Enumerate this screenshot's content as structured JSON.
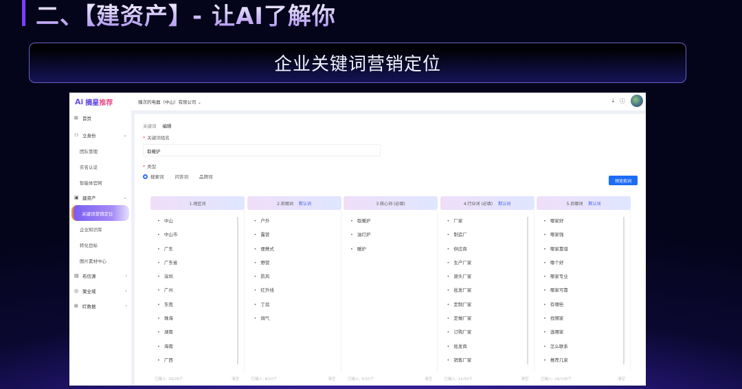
{
  "slide": {
    "title": "二、【建资产】- 让AI了解你",
    "banner": "企业关键词营销定位"
  },
  "app": {
    "logo": {
      "ai": "Ai",
      "name1": "摘星",
      "name2": "推荐"
    },
    "company": "臻次的电器（中山）有限公司",
    "sidebar": [
      {
        "label": "首页",
        "icon": "grid-icon",
        "type": "top"
      },
      {
        "label": "立身份",
        "icon": "user-icon",
        "type": "group",
        "open": true
      },
      {
        "label": "团队管理",
        "type": "sub"
      },
      {
        "label": "实名认证",
        "type": "sub"
      },
      {
        "label": "智能体官网",
        "type": "sub"
      },
      {
        "label": "建资产",
        "icon": "monitor-icon",
        "type": "group",
        "open": true
      },
      {
        "label": "关键词营销定位",
        "type": "sub",
        "active": true
      },
      {
        "label": "企业知识库",
        "type": "sub"
      },
      {
        "label": "转化目标",
        "type": "sub"
      },
      {
        "label": "图片素材中心",
        "type": "sub"
      },
      {
        "label": "布信源",
        "icon": "book-icon",
        "type": "group"
      },
      {
        "label": "聚全域",
        "icon": "globe-icon",
        "type": "group"
      },
      {
        "label": "盯数据",
        "icon": "grid-icon",
        "type": "group"
      }
    ],
    "breadcrumb": {
      "parent": "关键词",
      "current": "编辑"
    },
    "form": {
      "name_label": "关键词组名",
      "name_value": "取暖炉",
      "type_label": "类型",
      "types": [
        "搜索词",
        "问答词",
        "品牌词"
      ],
      "selected_type": "搜索词"
    },
    "preview_button": "预览拓词",
    "clear_label": "清空",
    "default_label": "默认词",
    "columns": [
      {
        "title": "1.地区词",
        "default": false,
        "items": [
          "中山",
          "中山市",
          "广东",
          "广东省",
          "深圳",
          "广州",
          "东莞",
          "珠海",
          "湖南",
          "海南",
          "广西"
        ],
        "count": "已输入: 26/26个"
      },
      {
        "title": "2.前缀词",
        "default": true,
        "items": [
          "户外",
          "露营",
          "便携式",
          "野营",
          "防风",
          "红外线",
          "丁烷",
          "焗气"
        ],
        "count": "已输入: 8/10个"
      },
      {
        "title": "3.核心词 (必填)",
        "default": false,
        "items": [
          "取暖炉",
          "油灯炉",
          "暖炉"
        ],
        "count": "已输入: 3/10个"
      },
      {
        "title": "4.行业词 (必填)",
        "default": true,
        "items": [
          "厂家",
          "制造厂",
          "供应商",
          "生产厂家",
          "源头厂家",
          "批发厂家",
          "定制厂家",
          "定做厂家",
          "订购厂家",
          "批发商",
          "销售厂家"
        ],
        "count": "已输入: 11/50个"
      },
      {
        "title": "5.后缀词",
        "default": true,
        "items": [
          "哪家好",
          "哪家强",
          "哪家靠谱",
          "哪个好",
          "哪家专业",
          "哪家可靠",
          "有哪些",
          "找哪家",
          "选哪家",
          "怎么联系",
          "推荐几家"
        ],
        "count": "已输入: 26/100个"
      }
    ]
  }
}
